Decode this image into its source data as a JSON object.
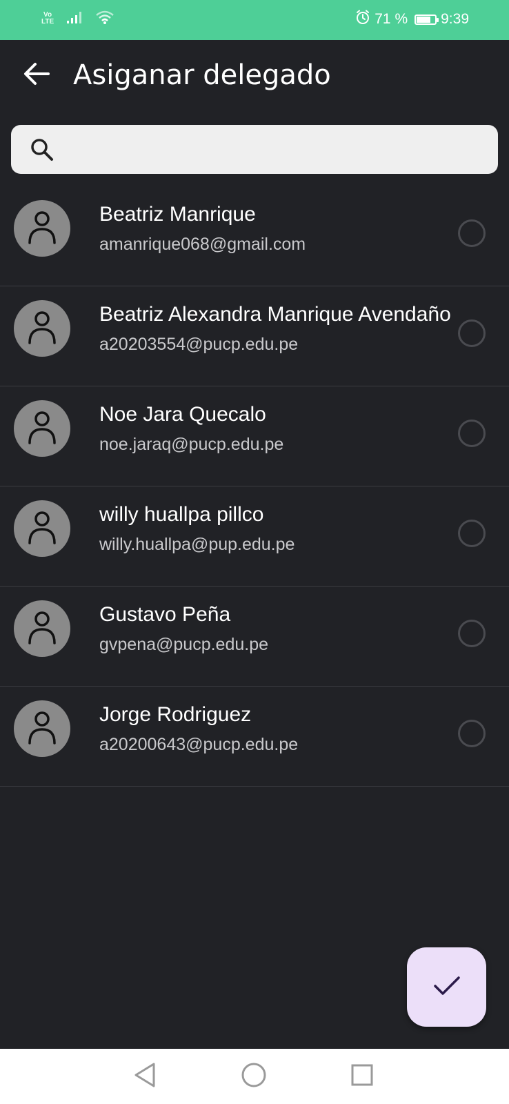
{
  "status_bar": {
    "network_label_top": "Vo",
    "network_label_bottom": "LTE",
    "battery_text": "71 %",
    "battery_level": 0.71,
    "time": "9:39",
    "icons": [
      "signal-icon",
      "wifi-icon",
      "alarm-icon",
      "battery-icon"
    ]
  },
  "app_bar": {
    "back_icon": "arrow-left-icon",
    "title": "Asiganar delegado"
  },
  "search": {
    "icon": "search-icon",
    "value": "",
    "placeholder": ""
  },
  "contacts": [
    {
      "name": "Beatriz Manrique",
      "email": "amanrique068@gmail.com",
      "selected": false
    },
    {
      "name": "Beatriz Alexandra Manrique Avendaño",
      "email": "a20203554@pucp.edu.pe",
      "selected": false
    },
    {
      "name": "Noe Jara Quecalo",
      "email": "noe.jaraq@pucp.edu.pe",
      "selected": false
    },
    {
      "name": "willy huallpa pillco",
      "email": "willy.huallpa@pup.edu.pe",
      "selected": false
    },
    {
      "name": "Gustavo Peña",
      "email": "gvpena@pucp.edu.pe",
      "selected": false
    },
    {
      "name": "Jorge Rodriguez",
      "email": "a20200643@pucp.edu.pe",
      "selected": false
    }
  ],
  "fab": {
    "icon": "check-icon"
  },
  "nav_bar": {
    "icons": [
      "back-triangle-icon",
      "home-circle-icon",
      "recents-square-icon"
    ]
  },
  "colors": {
    "status_bar_bg": "#4ecf97",
    "background": "#212226",
    "search_bg": "#efefef",
    "avatar_bg": "#8a8a8a",
    "fab_bg": "#ecdff9",
    "fab_icon": "#2b1a4a"
  }
}
